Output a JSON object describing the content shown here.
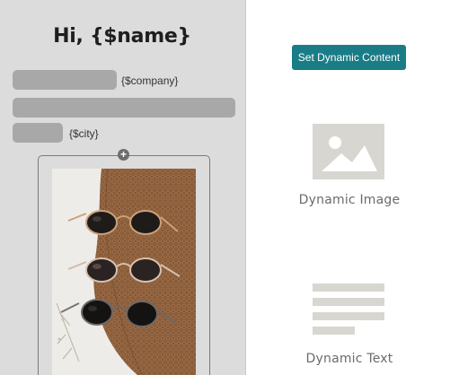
{
  "email_preview": {
    "greeting": "Hi, {$name}",
    "company_placeholder": "{$company}",
    "city_placeholder": "{$city}",
    "add_icon": "plus-circle-icon"
  },
  "sidebar": {
    "set_dynamic_button": "Set Dynamic Content",
    "tiles": [
      {
        "label": "Dynamic Image",
        "icon": "image-placeholder-icon"
      },
      {
        "label": "Dynamic Text",
        "icon": "text-lines-icon"
      }
    ]
  },
  "colors": {
    "accent": "#1a7c86",
    "preview_background": "#dcdcdc",
    "placeholder_bar": "#a8a8a8",
    "icon_fill": "#d7d6d0"
  }
}
